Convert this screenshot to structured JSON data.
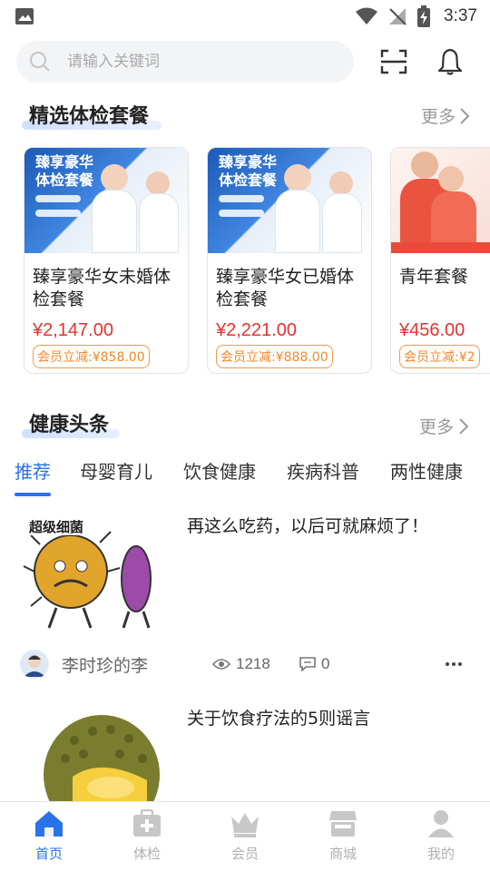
{
  "status_bar": {
    "time": "3:37"
  },
  "search": {
    "placeholder": "请输入关键词"
  },
  "packages_section": {
    "title": "精选体检套餐",
    "more": "更多",
    "items": [
      {
        "image_text_line1": "臻享豪华",
        "image_text_line2": "体检套餐",
        "name": "臻享豪华女未婚体检套餐",
        "price": "¥2,147.00",
        "discount": "会员立减:¥858.00"
      },
      {
        "image_text_line1": "臻享豪华",
        "image_text_line2": "体检套餐",
        "name": "臻享豪华女已婚体检套餐",
        "price": "¥2,221.00",
        "discount": "会员立减:¥888.00"
      },
      {
        "name": "青年套餐",
        "price": "¥456.00",
        "discount": "会员立减:¥2"
      }
    ]
  },
  "news_section": {
    "title": "健康头条",
    "more": "更多",
    "tabs": [
      "推荐",
      "母婴育儿",
      "饮食健康",
      "疾病科普",
      "两性健康"
    ],
    "active_tab": 0,
    "articles": [
      {
        "title": "再这么吃药，以后可就麻烦了！",
        "thumb_text": "超级细菌",
        "author": "李时珍的李",
        "views": "1218",
        "comments": "0"
      },
      {
        "title": "关于饮食疗法的5则谣言"
      }
    ]
  },
  "bottom_nav": {
    "items": [
      {
        "label": "首页",
        "icon": "home-icon",
        "active": true
      },
      {
        "label": "体检",
        "icon": "medical-kit-icon",
        "active": false
      },
      {
        "label": "会员",
        "icon": "crown-icon",
        "active": false
      },
      {
        "label": "商城",
        "icon": "store-icon",
        "active": false
      },
      {
        "label": "我的",
        "icon": "user-icon",
        "active": false
      }
    ]
  },
  "colors": {
    "accent": "#2a72e8",
    "price": "#e6312f",
    "discount": "#f0882e",
    "muted": "#999999"
  }
}
